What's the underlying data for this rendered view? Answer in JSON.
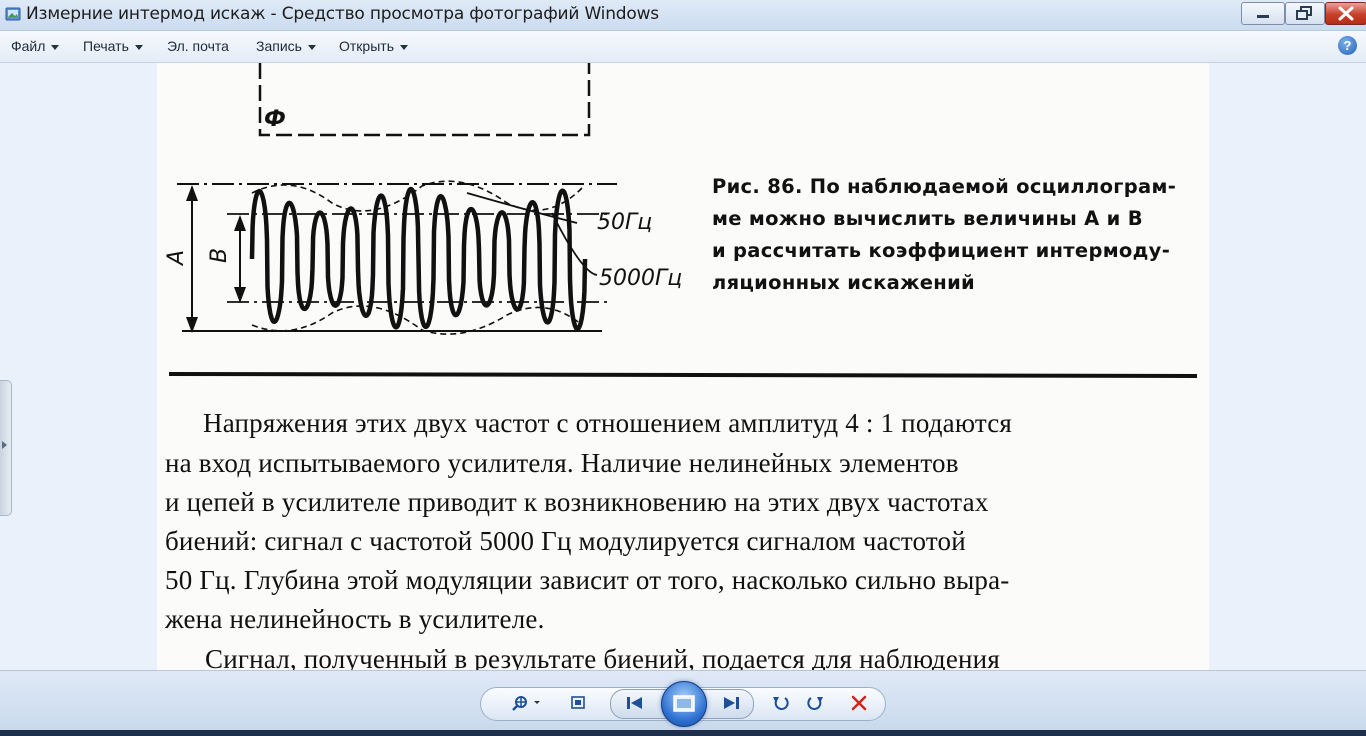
{
  "window": {
    "title": "Измерние интермод искаж - Средство просмотра фотографий Windows"
  },
  "menu": {
    "items": [
      {
        "label": "Файл",
        "has_arrow": true
      },
      {
        "label": "Печать",
        "has_arrow": true
      },
      {
        "label": "Эл. почта",
        "has_arrow": false
      },
      {
        "label": "Запись",
        "has_arrow": true
      },
      {
        "label": "Открыть",
        "has_arrow": true
      }
    ],
    "help_label": "?"
  },
  "document": {
    "figure_labels": {
      "phi": "Ф",
      "a": "A",
      "b": "B",
      "f1": "50Гц",
      "f2": "5000Гц"
    },
    "caption": [
      "Рис. 86. По наблюдаемой осциллограм-",
      "ме можно вычислить величины A и B",
      "и рассчитать коэффициент интермоду-",
      "ляционных искажений"
    ],
    "paragraph": [
      "Напряжения этих двух частот с отношением амплитуд 4 : 1 подаются",
      "на вход испытываемого усилителя. Наличие нелинейных элементов",
      "и цепей в усилителе приводит к возникновению на этих двух частотах",
      "биений: сигнал с частотой 5000 Гц модулируется сигналом частотой",
      "50 Гц. Глубина этой модуляции зависит от того, насколько сильно выра-",
      "жена нелинейность в усилителе.",
      "Сигнал, полученный в результате биений, подается для наблюдения"
    ]
  },
  "toolbar": {
    "buttons": [
      {
        "name": "zoom-button",
        "icon": "magnifier-icon"
      },
      {
        "name": "actual-size-button",
        "icon": "fit-icon"
      },
      {
        "name": "previous-button",
        "icon": "skip-back-icon"
      },
      {
        "name": "slideshow-button",
        "icon": "slideshow-icon"
      },
      {
        "name": "next-button",
        "icon": "skip-forward-icon"
      },
      {
        "name": "rotate-ccw-button",
        "icon": "rotate-left-icon"
      },
      {
        "name": "rotate-cw-button",
        "icon": "rotate-right-icon"
      },
      {
        "name": "delete-button",
        "icon": "delete-icon"
      }
    ]
  },
  "colors": {
    "accent": "#2b6fd0",
    "delete": "#d3241a",
    "close": "#c8402a"
  }
}
